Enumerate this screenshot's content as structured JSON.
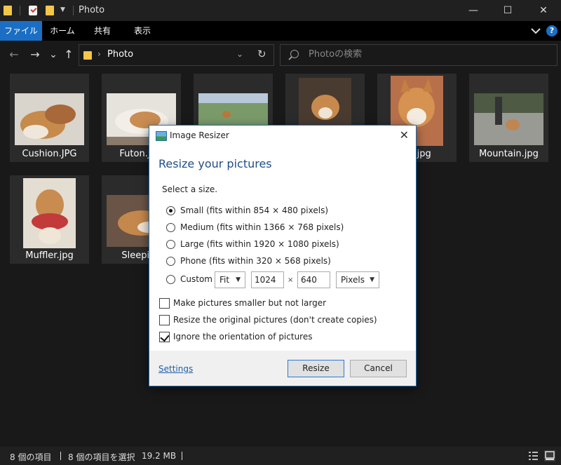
{
  "window": {
    "title": "Photo",
    "minimize_glyph": "—",
    "maximize_glyph": "☐",
    "close_glyph": "✕"
  },
  "ribbon": {
    "tabs": [
      "ファイル",
      "ホーム",
      "共有",
      "表示"
    ],
    "help_glyph": "?"
  },
  "nav": {
    "back_glyph": "←",
    "forward_glyph": "→",
    "recent_glyph": "⌄",
    "up_glyph": "↑",
    "breadcrumb_sep": "›",
    "address": "Photo",
    "address_dropdown_glyph": "⌄",
    "refresh_glyph": "↻",
    "search_placeholder": "Photoの検索"
  },
  "files": [
    {
      "name": "Cushion.JPG",
      "icon": "photo-thumbnail"
    },
    {
      "name": "Futon.JPG",
      "icon": "photo-thumbnail"
    },
    {
      "name": "",
      "icon": "photo-thumbnail"
    },
    {
      "name": "",
      "icon": "photo-thumbnail"
    },
    {
      "name": "na.jpg",
      "icon": "photo-thumbnail"
    },
    {
      "name": "Mountain.jpg",
      "icon": "photo-thumbnail"
    },
    {
      "name": "Muffler.jpg",
      "icon": "photo-thumbnail"
    },
    {
      "name": "Sleeping",
      "icon": "photo-thumbnail"
    }
  ],
  "status": {
    "item_count": "8 個の項目",
    "selected": "8 個の項目を選択",
    "size": "19.2 MB"
  },
  "dialog": {
    "title": "Image Resizer",
    "close_glyph": "✕",
    "heading": "Resize your pictures",
    "subheading": "Select a size.",
    "sizes": [
      {
        "label": "Small (fits within 854 × 480 pixels)",
        "selected": true
      },
      {
        "label": "Medium (fits within 1366 × 768 pixels)",
        "selected": false
      },
      {
        "label": "Large (fits within 1920 × 1080 pixels)",
        "selected": false
      },
      {
        "label": "Phone (fits within 320 × 568 pixels)",
        "selected": false
      }
    ],
    "custom": {
      "label": "Custom",
      "mode": "Fit",
      "width": "1024",
      "times": "×",
      "height": "640",
      "unit": "Pixels"
    },
    "options": [
      {
        "label": "Make pictures smaller but not larger",
        "checked": false
      },
      {
        "label": "Resize the original pictures (don't create copies)",
        "checked": false
      },
      {
        "label": "Ignore the orientation of pictures",
        "checked": true
      }
    ],
    "settings_link": "Settings",
    "resize_button": "Resize",
    "cancel_button": "Cancel"
  },
  "colors": {
    "accent": "#1a6fc4",
    "heading": "#1f4e87",
    "link": "#1f5fa6"
  }
}
